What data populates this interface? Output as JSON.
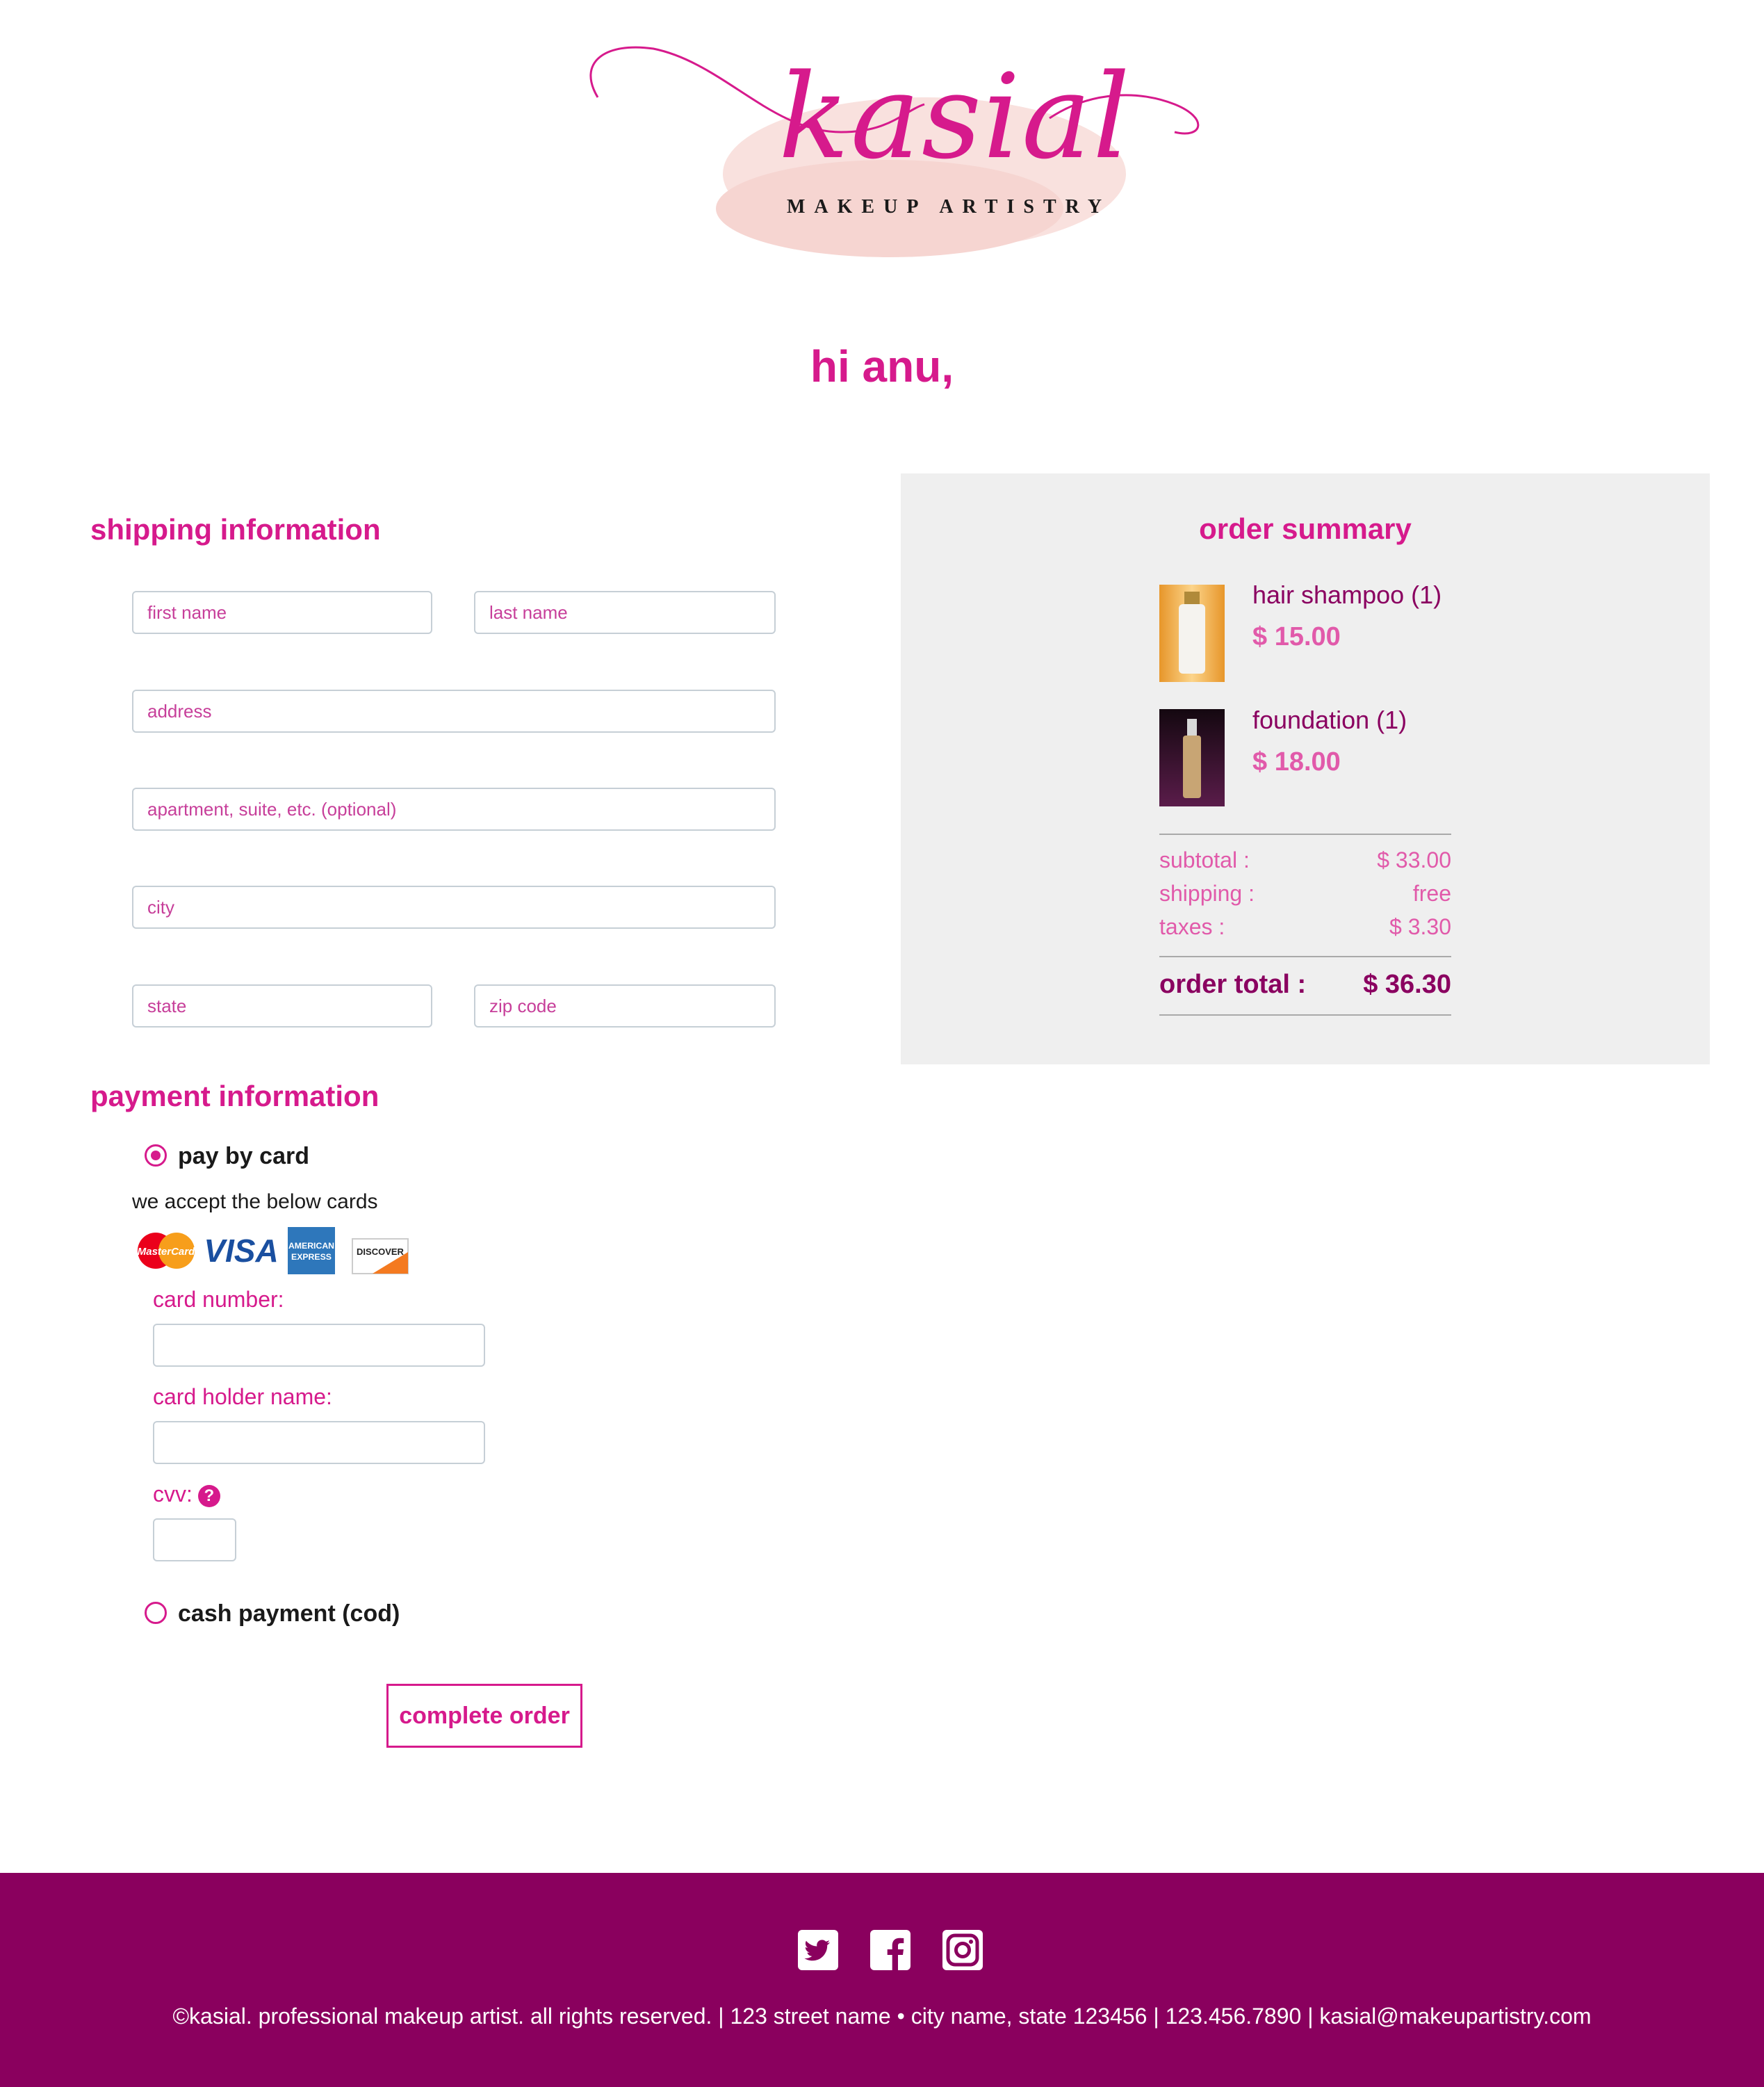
{
  "brand": {
    "name": "kasial",
    "tagline": "MAKEUP ARTISTRY",
    "primary_color": "#d61a8c",
    "dark_color": "#8a005e",
    "accent_color": "#e15aaa"
  },
  "greeting": "hi anu,",
  "shipping": {
    "title": "shipping information",
    "fields": {
      "first_name": "first name",
      "last_name": "last name",
      "address": "address",
      "apartment": "apartment, suite, etc. (optional)",
      "city": "city",
      "state": "state",
      "zip": "zip code"
    }
  },
  "payment": {
    "title": "payment information",
    "options": {
      "card": "pay by card",
      "cod": "cash payment (cod)"
    },
    "selected": "card",
    "accept_text": "we accept the below cards",
    "cards": {
      "mastercard": "MasterCard",
      "visa": "VISA",
      "amex_line1": "AMERICAN",
      "amex_line2": "EXPRESS",
      "discover": "DISCOVER"
    },
    "card_number_label": "card number:",
    "card_holder_label": "card holder name:",
    "cvv_label": "cvv:",
    "help_glyph": "?",
    "submit_label": "complete order"
  },
  "summary": {
    "title": "order summary",
    "items": [
      {
        "name": "hair shampoo (1)",
        "price": "$ 15.00",
        "icon": "shampoo-bottle-icon"
      },
      {
        "name": "foundation (1)",
        "price": "$ 18.00",
        "icon": "foundation-bottle-icon"
      }
    ],
    "rows": [
      {
        "label": "subtotal :",
        "value": "$ 33.00"
      },
      {
        "label": "shipping :",
        "value": "free"
      },
      {
        "label": "taxes :",
        "value": "$ 3.30"
      }
    ],
    "total_label": "order total :",
    "total_value": "$ 36.30"
  },
  "footer": {
    "social": [
      "twitter-icon",
      "facebook-icon",
      "instagram-icon"
    ],
    "text": "©kasial. professional makeup artist. all rights reserved. | 123 street name • city name, state 123456 | 123.456.7890 | kasial@makeupartistry.com"
  }
}
